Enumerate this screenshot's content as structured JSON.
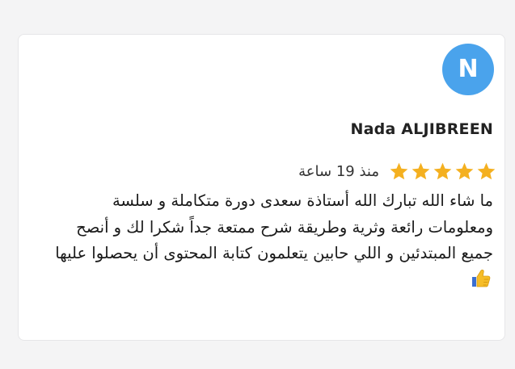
{
  "review": {
    "avatar_initial": "N",
    "avatar_color": "#4aa3ec",
    "reviewer_name": "Nada ALJIBREEN",
    "rating": 5,
    "rating_max": 5,
    "star_color": "#f4b020",
    "time_ago": "منذ 19 ساعة",
    "text": "ما شاء الله تبارك الله أستاذة سعدى دورة متكاملة و سلسة ومعلومات رائعة وثرية وطريقة شرح ممتعة جداً شكرا لك و أنصح جميع المبتدئين و اللي حابين يتعلمون كتابة المحتوى أن يحصلوا عليها",
    "emoji_icon": "thumbs-up-icon"
  }
}
